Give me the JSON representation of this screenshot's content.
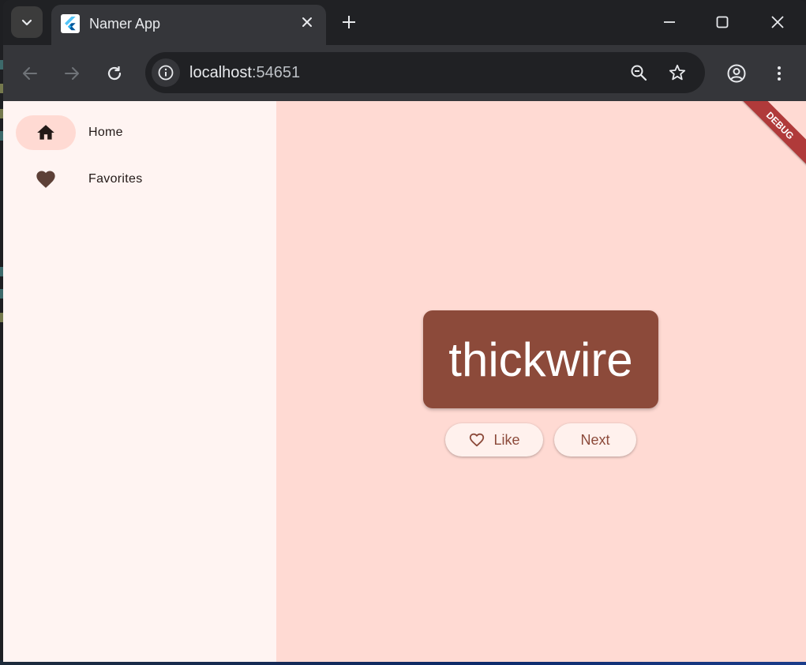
{
  "browser": {
    "tab_title": "Namer App",
    "url_host": "localhost",
    "url_port": ":54651"
  },
  "app": {
    "rail": {
      "items": [
        {
          "label": "Home",
          "icon": "home-icon",
          "selected": true
        },
        {
          "label": "Favorites",
          "icon": "heart-icon",
          "selected": false
        }
      ]
    },
    "word": "thickwire",
    "like_label": "Like",
    "next_label": "Next",
    "debug_banner": "DEBUG"
  },
  "colors": {
    "rail_bg": "#fff4f2",
    "content_bg": "#ffdad3",
    "card": "#8c4a3a",
    "button_text": "#8c4a3a",
    "debug_banner": "#b03a3a"
  }
}
